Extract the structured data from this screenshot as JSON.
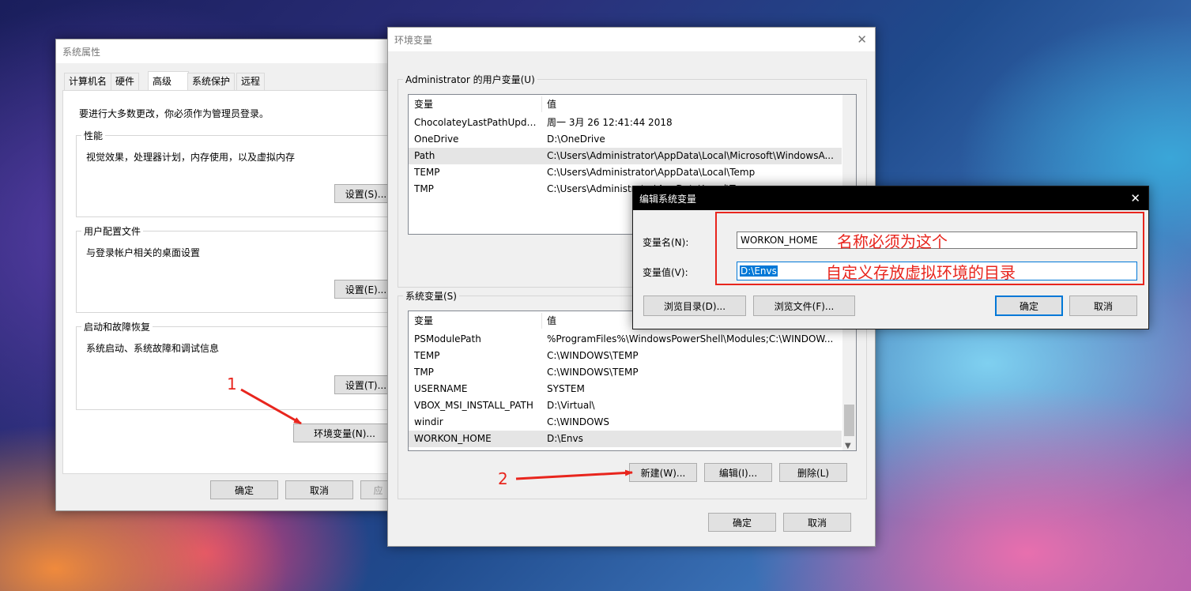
{
  "sys_props": {
    "title": "系统属性",
    "tabs": [
      "计算机名",
      "硬件",
      "高级",
      "系统保护",
      "远程"
    ],
    "admin_note": "要进行大多数更改，你必须作为管理员登录。",
    "performance": {
      "title": "性能",
      "desc": "视觉效果，处理器计划，内存使用，以及虚拟内存",
      "button": "设置(S)..."
    },
    "user_profile": {
      "title": "用户配置文件",
      "desc": "与登录帐户相关的桌面设置",
      "button": "设置(E)..."
    },
    "startup": {
      "title": "启动和故障恢复",
      "desc": "系统启动、系统故障和调试信息",
      "button": "设置(T)..."
    },
    "env_button": "环境变量(N)...",
    "ok": "确定",
    "cancel": "取消",
    "apply": "应"
  },
  "env_vars": {
    "title": "环境变量",
    "user_group": "Administrator 的用户变量(U)",
    "user_columns": [
      "变量",
      "值"
    ],
    "user_rows": [
      [
        "ChocolateyLastPathUpdate",
        "周一 3月 26 12:41:44 2018"
      ],
      [
        "OneDrive",
        "D:\\OneDrive"
      ],
      [
        "Path",
        "C:\\Users\\Administrator\\AppData\\Local\\Microsoft\\WindowsA..."
      ],
      [
        "TEMP",
        "C:\\Users\\Administrator\\AppData\\Local\\Temp"
      ],
      [
        "TMP",
        "C:\\Users\\Administrator\\AppData\\Local\\Temp"
      ]
    ],
    "sys_group": "系统变量(S)",
    "sys_columns": [
      "变量",
      "值"
    ],
    "sys_rows": [
      [
        "PSModulePath",
        "%ProgramFiles%\\WindowsPowerShell\\Modules;C:\\WINDOW..."
      ],
      [
        "TEMP",
        "C:\\WINDOWS\\TEMP"
      ],
      [
        "TMP",
        "C:\\WINDOWS\\TEMP"
      ],
      [
        "USERNAME",
        "SYSTEM"
      ],
      [
        "VBOX_MSI_INSTALL_PATH",
        "D:\\Virtual\\"
      ],
      [
        "windir",
        "C:\\WINDOWS"
      ],
      [
        "WORKON_HOME",
        "D:\\Envs"
      ]
    ],
    "new_button": "新建(W)...",
    "edit_button": "编辑(I)...",
    "delete_button": "删除(L)",
    "ok": "确定",
    "cancel": "取消"
  },
  "edit_dialog": {
    "title": "编辑系统变量",
    "name_label": "变量名(N):",
    "name_value": "WORKON_HOME",
    "value_label": "变量值(V):",
    "value_value": "D:\\Envs",
    "browse_dir": "浏览目录(D)...",
    "browse_file": "浏览文件(F)...",
    "ok": "确定",
    "cancel": "取消"
  },
  "annotations": {
    "step1": "1",
    "step2": "2",
    "name_note": "名称必须为这个",
    "value_note": "自定义存放虚拟环境的目录",
    "color": "#e8251d"
  }
}
